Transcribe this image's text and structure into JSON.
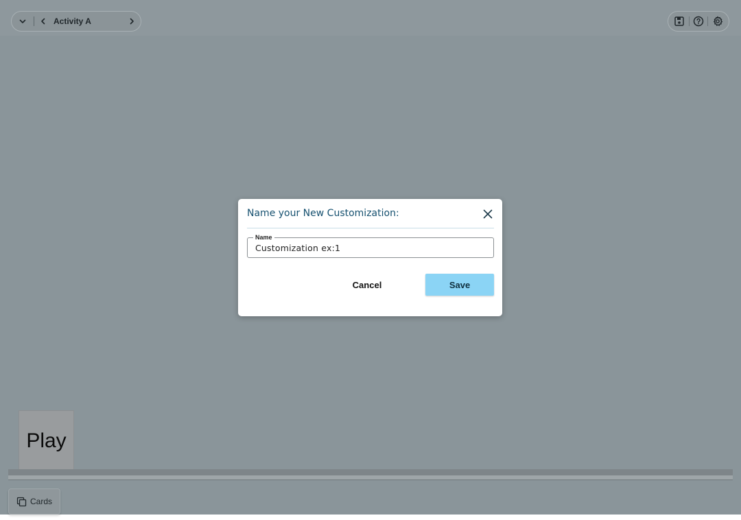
{
  "toolbar": {
    "activity_title": "Activity A",
    "icons": {
      "dropdown": "chevron-down-icon",
      "prev": "chevron-left-icon",
      "next": "chevron-right-icon",
      "save": "save-icon",
      "help": "help-icon",
      "settings": "gear-icon"
    }
  },
  "canvas": {
    "play_card_label": "Play",
    "cards_button_label": "Cards",
    "cards_icon": "cards-stack-icon"
  },
  "dialog": {
    "title": "Name your New Customization:",
    "close_icon": "close-icon",
    "name_field": {
      "label": "Name",
      "value": "Customization ex:1"
    },
    "cancel_label": "Cancel",
    "save_label": "Save"
  },
  "colors": {
    "overlay": "#8a959a",
    "dialog_title": "#15506f",
    "save_button": "#8bd4f5"
  }
}
